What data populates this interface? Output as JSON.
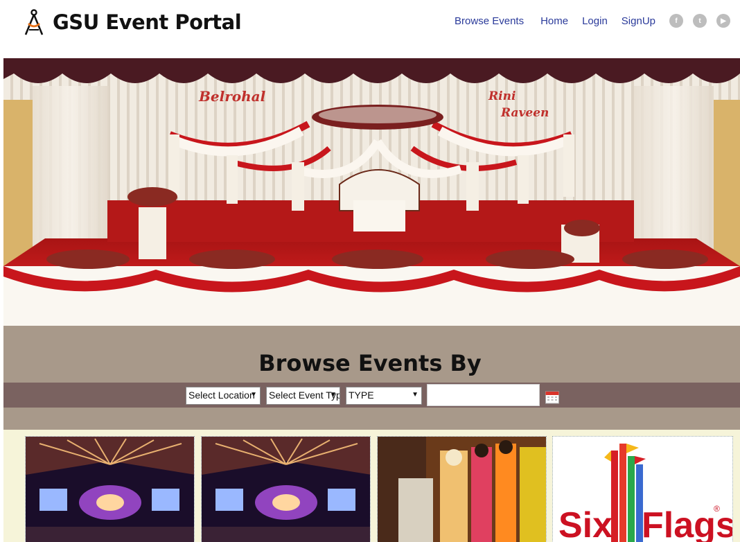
{
  "header": {
    "brand": "GSU Event Portal",
    "nav": [
      "Browse Events",
      "Home",
      "Login",
      "SignUp"
    ],
    "social": [
      {
        "icon": "facebook-icon",
        "glyph": "f"
      },
      {
        "icon": "twitter-icon",
        "glyph": "t"
      },
      {
        "icon": "youtube-icon",
        "glyph": "▶"
      }
    ]
  },
  "hero": {
    "banner_left": "Belrohal",
    "banner_right_1": "Rini",
    "banner_right_2": "Raveen"
  },
  "browse": {
    "title": "Browse Events By",
    "location_select": "Select Location",
    "event_type_select": "Select Event Type",
    "type_select": "TYPE",
    "date_value": ""
  },
  "cards": [
    {
      "kind": "concert"
    },
    {
      "kind": "concert"
    },
    {
      "kind": "wedding"
    },
    {
      "kind": "logo",
      "logo_left": "Six",
      "logo_right": "Flags",
      "logo_mark": "®"
    }
  ],
  "colors": {
    "nav_link": "#2a3a9a",
    "browse_band": "#a8998a",
    "filter_bar": "#7a6260",
    "cards_area": "#f6f4d9",
    "sixflags_red": "#cc1122"
  }
}
